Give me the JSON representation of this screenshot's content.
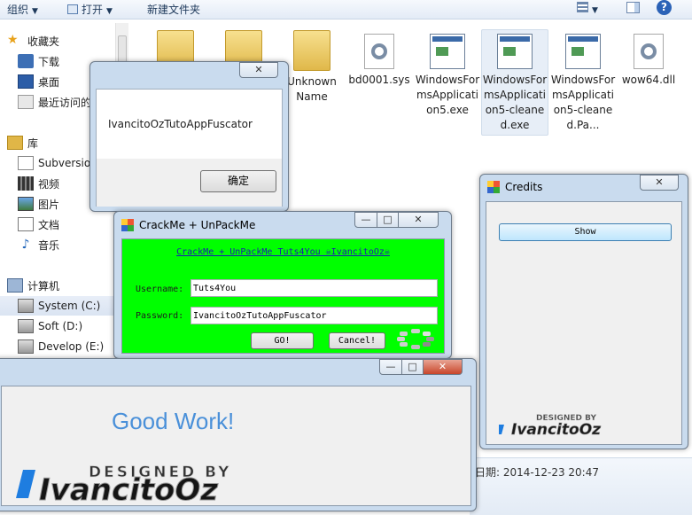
{
  "explorer": {
    "toolbar": {
      "organize": "组织",
      "open": "打开",
      "new_folder": "新建文件夹"
    },
    "nav": {
      "favorites": "收藏夹",
      "downloads": "下载",
      "desktop": "桌面",
      "recent": "最近访问的位置",
      "libraries": "库",
      "subversion": "Subversion",
      "videos": "视频",
      "pictures": "图片",
      "documents": "文档",
      "music": "音乐",
      "computer": "计算机",
      "drive_c": "System (C:)",
      "drive_d": "Soft (D:)",
      "drive_e": "Develop (E:)"
    },
    "files": [
      {
        "name": "Unknown Name"
      },
      {
        "name": "bd0001.sys"
      },
      {
        "name": "WindowsFormsApplication5.exe"
      },
      {
        "name": "WindowsFormsApplication5-cleaned.exe"
      },
      {
        "name": "WindowsFormsApplication5-cleaned.Pa..."
      },
      {
        "name": "wow64.dll"
      }
    ],
    "details_text": "日期: 2014-12-23 20:47"
  },
  "msgbox": {
    "text": "IvancitoOzTutoAppFuscator",
    "ok_label": "确定"
  },
  "crackme": {
    "title": "CrackMe + UnPackMe",
    "link_text": "CrackMe + UnPackMe Tuts4You ☠IvancitoOz☠",
    "username_label": "Username:",
    "username_value": "Tuts4You",
    "password_label": "Password:",
    "password_value": "IvancitoOzTutoAppFuscator",
    "go_label": "GO!",
    "cancel_label": "Cancel!"
  },
  "credits": {
    "title": "Credits",
    "show_label": "Show"
  },
  "goodwork": {
    "message": "Good Work!",
    "message_color": "#4a90d9"
  },
  "colors": {
    "crackme_bg": "#00ff00",
    "link": "#1a1ab0"
  }
}
